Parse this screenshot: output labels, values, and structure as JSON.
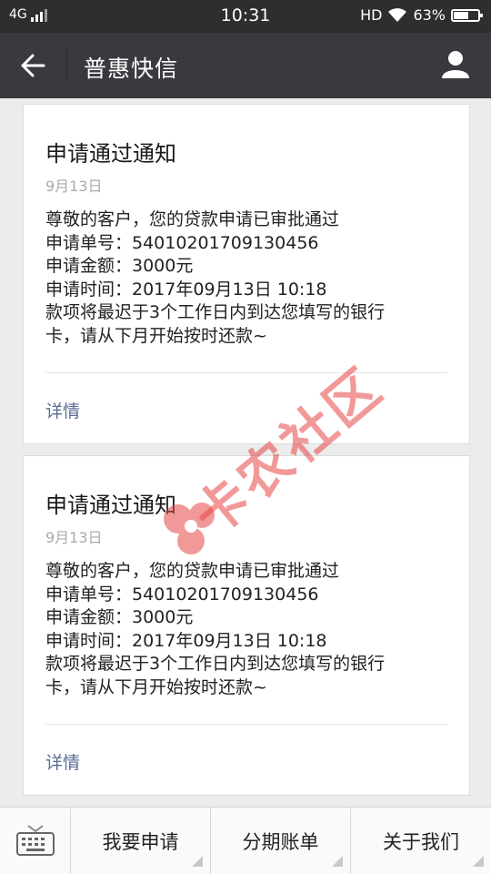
{
  "status_bar": {
    "network": "4G",
    "time": "10:31",
    "hd": "HD",
    "battery_percent": "63%",
    "battery_level": 0.63
  },
  "header": {
    "title": "普惠快信",
    "back_icon": "arrow-left-icon",
    "profile_icon": "person-icon"
  },
  "messages": [
    {
      "title": "申请通过通知",
      "date": "9月13日",
      "lines": [
        "尊敬的客户，您的贷款申请已审批通过",
        "申请单号：54010201709130456",
        "申请金额：3000元",
        "申请时间：2017年09月13日 10:18",
        "款项将最迟于3个工作日内到达您填写的银行",
        "卡，请从下月开始按时还款~"
      ],
      "detail_label": "详情"
    },
    {
      "title": "申请通过通知",
      "date": "9月13日",
      "lines": [
        "尊敬的客户，您的贷款申请已审批通过",
        "申请单号：54010201709130456",
        "申请金额：3000元",
        "申请时间：2017年09月13日 10:18",
        "款项将最迟于3个工作日内到达您填写的银行",
        "卡，请从下月开始按时还款~"
      ],
      "detail_label": "详情"
    }
  ],
  "watermark": {
    "text": "卡农社区"
  },
  "bottom_menu": {
    "keyboard_icon": "keyboard-icon",
    "items": [
      "我要申请",
      "分期账单",
      "关于我们"
    ]
  },
  "colors": {
    "status_bar": "#2e2e31",
    "header": "#393a3f",
    "link": "#576b95",
    "watermark": "#e64646"
  }
}
